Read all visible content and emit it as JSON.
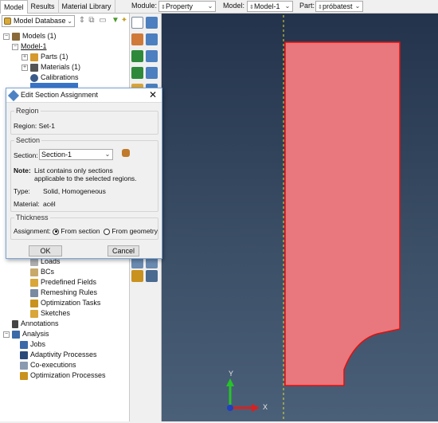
{
  "tabs": [
    {
      "label": "Model",
      "active": true
    },
    {
      "label": "Results",
      "active": false
    },
    {
      "label": "Material Library",
      "active": false
    }
  ],
  "context": {
    "module_label": "Module:",
    "module_value": "Property",
    "model_label": "Model:",
    "model_value": "Model-1",
    "part_label": "Part:",
    "part_value": "próbatest"
  },
  "tree": {
    "db_combo": "Model Database",
    "items": [
      {
        "label": "Models (1)"
      },
      {
        "label": "Model-1"
      },
      {
        "label": "Parts (1)"
      },
      {
        "label": "Materials (1)"
      },
      {
        "label": "Calibrations"
      },
      {
        "label": "Loads"
      },
      {
        "label": "BCs"
      },
      {
        "label": "Predefined Fields"
      },
      {
        "label": "Remeshing Rules"
      },
      {
        "label": "Optimization Tasks"
      },
      {
        "label": "Sketches"
      },
      {
        "label": "Annotations"
      },
      {
        "label": "Analysis"
      },
      {
        "label": "Jobs"
      },
      {
        "label": "Adaptivity Processes"
      },
      {
        "label": "Co-executions"
      },
      {
        "label": "Optimization Processes"
      }
    ]
  },
  "dialog": {
    "title": "Edit Section Assignment",
    "region_group": "Region",
    "region_text": "Region: Set-1",
    "section_group": "Section",
    "section_label": "Section:",
    "section_value": "Section-1",
    "note_label": "Note:",
    "note_line1": "List contains only sections",
    "note_line2": "applicable to the selected regions.",
    "type_label": "Type:",
    "type_value": "Solid, Homogeneous",
    "material_label": "Material:",
    "material_value": "acél",
    "thickness_group": "Thickness",
    "assignment_label": "Assignment:",
    "radio_from_section": "From section",
    "radio_from_geometry": "From geometry",
    "radio_selected": "From section",
    "ok_label": "OK",
    "cancel_label": "Cancel"
  },
  "viewport": {
    "axis_y": "Y",
    "axis_x": "X",
    "part_fill": "#e8787d",
    "part_edge": "#e01010"
  }
}
